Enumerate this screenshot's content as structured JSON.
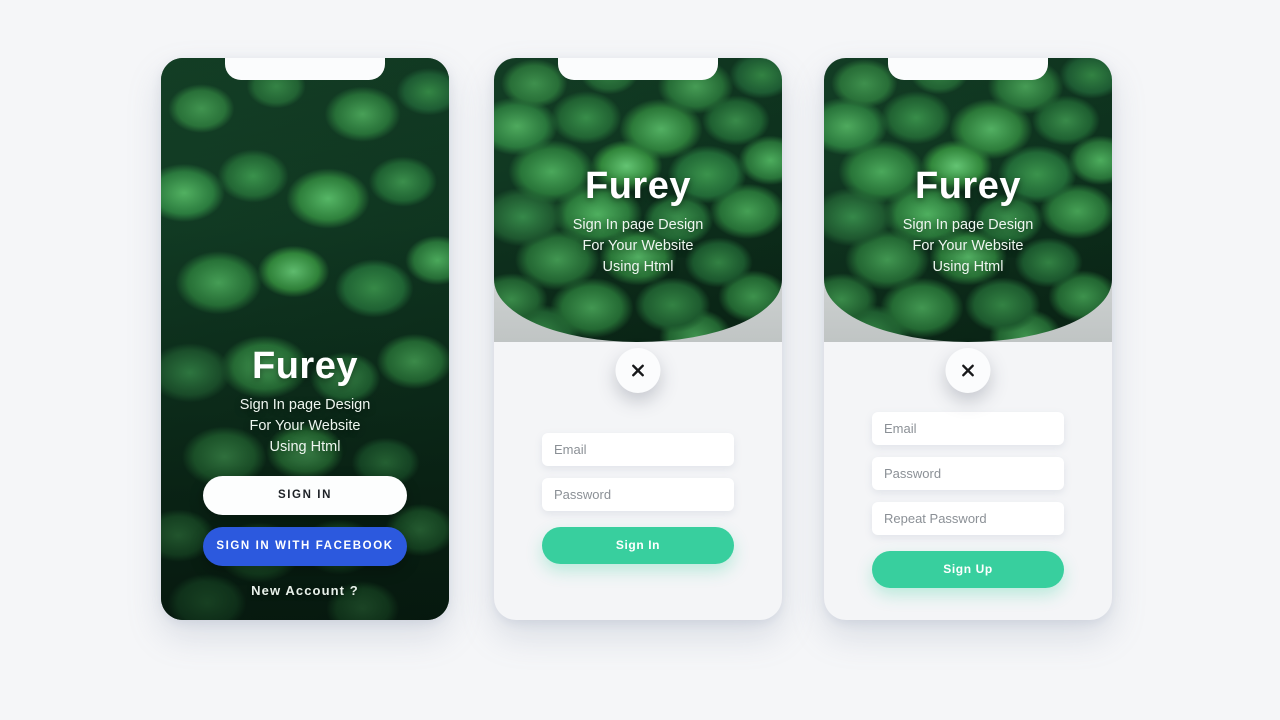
{
  "page": {
    "background_color": "#f5f6f8",
    "accent_green": "#38cf9e",
    "facebook_blue": "#2c59de"
  },
  "brand": {
    "logo": "Furey",
    "tagline_line1": "Sign In page Design",
    "tagline_line2": "For Your Website",
    "tagline_line3": "Using Html"
  },
  "cards": [
    {
      "id": "signin-intro",
      "buttons": {
        "sign_in": "SIGN IN",
        "facebook": "SIGN IN WITH FACEBOOK"
      },
      "links": {
        "new_account": "New Account ?"
      }
    },
    {
      "id": "signin-form",
      "close_icon": "close-icon",
      "fields": [
        {
          "name": "email",
          "placeholder": "Email",
          "value": ""
        },
        {
          "name": "password",
          "placeholder": "Password",
          "value": ""
        }
      ],
      "submit": "Sign In"
    },
    {
      "id": "signup-form",
      "close_icon": "close-icon",
      "fields": [
        {
          "name": "email",
          "placeholder": "Email",
          "value": ""
        },
        {
          "name": "password",
          "placeholder": "Password",
          "value": ""
        },
        {
          "name": "repeat_password",
          "placeholder": "Repeat Password",
          "value": ""
        }
      ],
      "submit": "Sign Up"
    }
  ]
}
